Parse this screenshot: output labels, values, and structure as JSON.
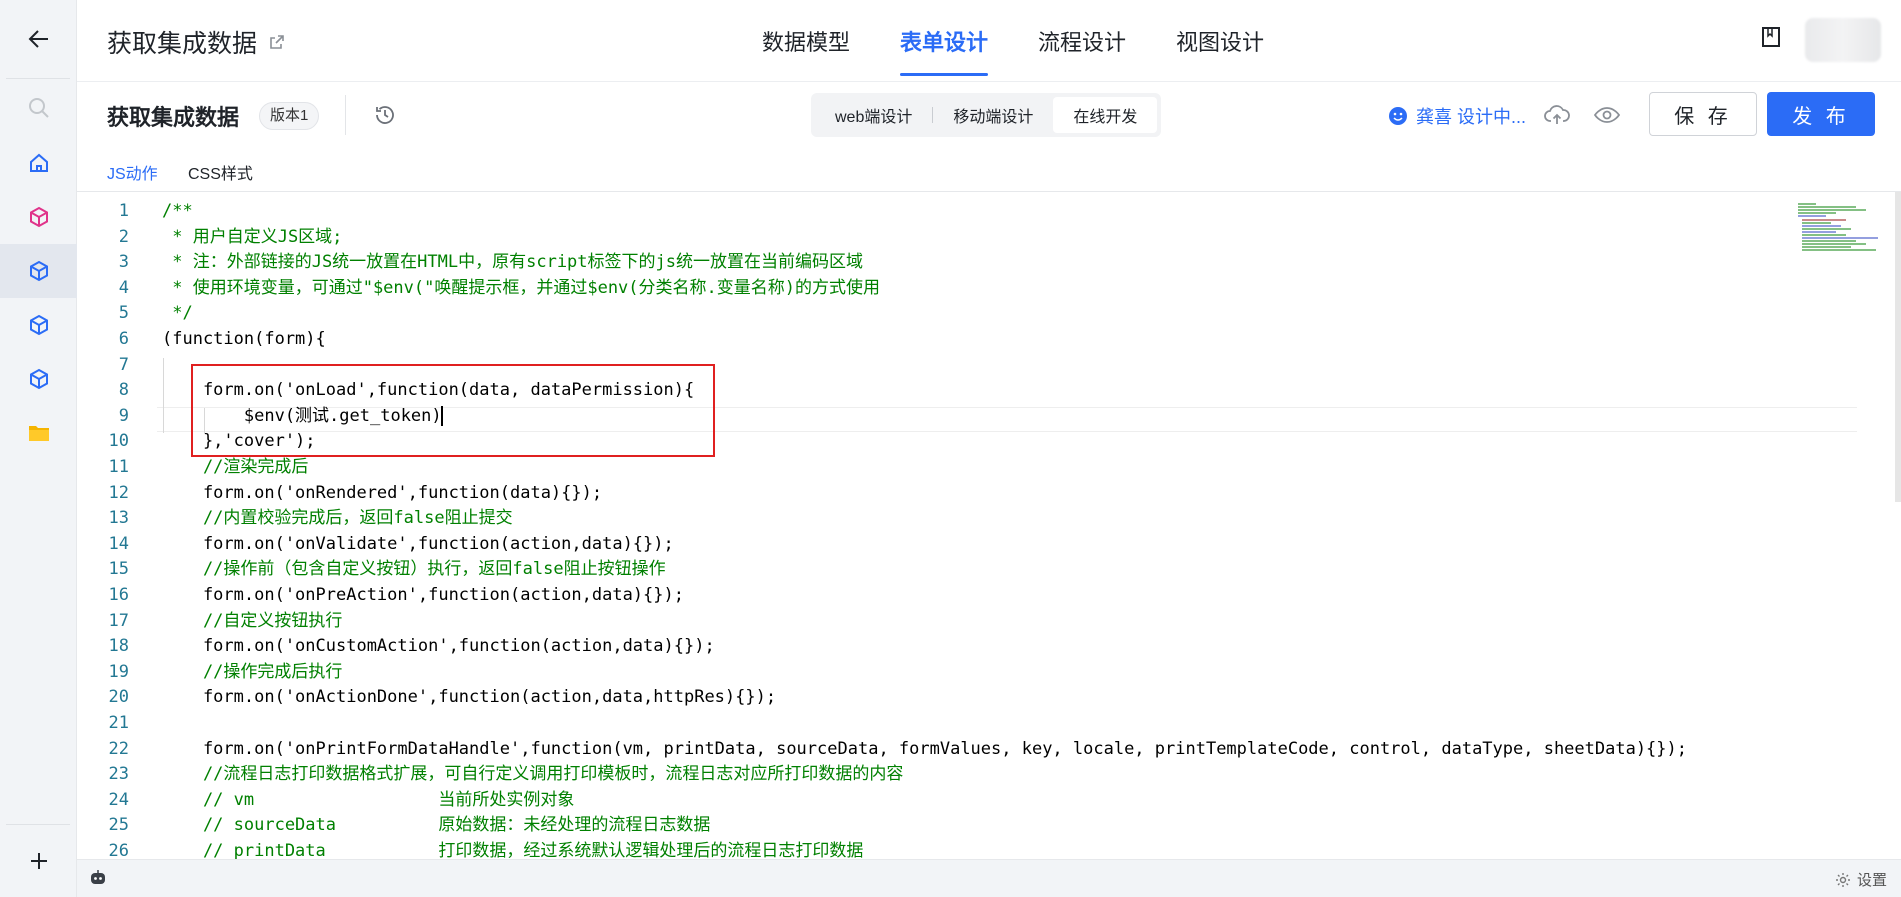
{
  "header": {
    "title": "获取集成数据",
    "tabs": [
      {
        "label": "数据模型",
        "active": false
      },
      {
        "label": "表单设计",
        "active": true
      },
      {
        "label": "流程设计",
        "active": false
      },
      {
        "label": "视图设计",
        "active": false
      }
    ]
  },
  "toolbar": {
    "form_name": "获取集成数据",
    "version_badge": "版本1",
    "modes": [
      {
        "label": "web端设计",
        "active": false
      },
      {
        "label": "移动端设计",
        "active": false
      },
      {
        "label": "在线开发",
        "active": true
      }
    ],
    "status_text": "龚喜 设计中...",
    "save_label": "保 存",
    "publish_label": "发 布"
  },
  "code_tabs": [
    {
      "label": "JS动作",
      "active": true
    },
    {
      "label": "CSS样式",
      "active": false
    }
  ],
  "editor": {
    "line_numbers": [
      "1",
      "2",
      "3",
      "4",
      "5",
      "6",
      "7",
      "8",
      "9",
      "10",
      "11",
      "12",
      "13",
      "14",
      "15",
      "16",
      "17",
      "18",
      "19",
      "20",
      "21",
      "22",
      "23",
      "24",
      "25",
      "26"
    ],
    "lines": [
      "/**",
      " * 用户自定义JS区域;",
      " * 注：外部链接的JS统一放置在HTML中，原有script标签下的js统一放置在当前编码区域",
      " * 使用环境变量，可通过\"$env(\"唤醒提示框，并通过$env(分类名称.变量名称)的方式使用",
      " */",
      "(function(form){",
      "",
      "    form.on('onLoad',function(data, dataPermission){",
      "        $env(测试.get_token)",
      "    },'cover');",
      "    //渲染完成后",
      "    form.on('onRendered',function(data){});",
      "    //内置校验完成后，返回false阻止提交",
      "    form.on('onValidate',function(action,data){});",
      "    //操作前（包含自定义按钮）执行，返回false阻止按钮操作",
      "    form.on('onPreAction',function(action,data){});",
      "    //自定义按钮执行",
      "    form.on('onCustomAction',function(action,data){});",
      "    //操作完成后执行",
      "    form.on('onActionDone',function(action,data,httpRes){});",
      "",
      "    form.on('onPrintFormDataHandle',function(vm, printData, sourceData, formValues, key, locale, printTemplateCode, control, dataType, sheetData){});",
      "    //流程日志打印数据格式扩展，可自行定义调用打印模板时，流程日志对应所打印数据的内容",
      "    // vm                  当前所处实例对象",
      "    // sourceData          原始数据：未经处理的流程日志数据",
      "    // printData           打印数据，经过系统默认逻辑处理后的流程日志打印数据"
    ]
  },
  "bottom": {
    "settings_label": "设置"
  },
  "icons": {
    "back": "arrow-left-icon",
    "search": "search-icon",
    "home": "home-icon",
    "cube": "cube-icon",
    "folder": "folder-icon",
    "plus": "plus-icon",
    "external": "external-link-icon",
    "history": "history-icon",
    "book": "book-icon",
    "cloud": "cloud-upload-icon",
    "eye": "eye-icon",
    "robot": "robot-icon",
    "settings": "gear-icon",
    "smile": "smile-icon"
  },
  "colors": {
    "accent": "#2b6cf6",
    "comment": "#008000",
    "string": "#a31515",
    "keyword": "#0000ff",
    "highlight_box": "#e02020"
  }
}
